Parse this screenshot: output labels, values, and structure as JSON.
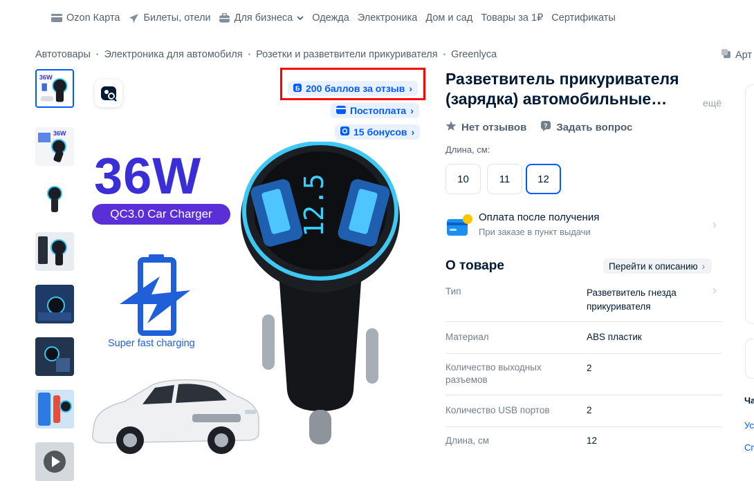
{
  "nav": {
    "items": [
      {
        "label": "Ozon Карта",
        "icon": "card-icon"
      },
      {
        "label": "Билеты, отели",
        "icon": "plane-icon"
      },
      {
        "label": "Для бизнеса",
        "icon": "business-icon",
        "dropdown": true
      },
      {
        "label": "Одежда"
      },
      {
        "label": "Электроника"
      },
      {
        "label": "Дом и сад"
      },
      {
        "label": "Товары за 1₽"
      },
      {
        "label": "Сертификаты"
      }
    ]
  },
  "breadcrumb": {
    "items": [
      "Автотовары",
      "Электроника для автомобиля",
      "Розетки и разветвители прикуривателя",
      "Greenlyca"
    ],
    "separator": "•",
    "article_label": "Арт"
  },
  "gallery": {
    "thumb_count": 8,
    "active_index": 0,
    "video_thumb": true
  },
  "main_image": {
    "headline": "36W",
    "subline": "QC3.0 Car Charger",
    "charging_caption": "Super fast charging",
    "display_reading": "12.5",
    "badges": {
      "reviews_points": "200 баллов за отзыв",
      "postpay": "Постоплата",
      "bonuses": "15 бонусов"
    }
  },
  "product": {
    "title": "Разветвитель прикуривателя (зарядка) автомобильные…",
    "more_label": "ещё",
    "rating_text": "Нет отзывов",
    "ask_question": "Задать вопрос",
    "length_label": "Длина, см:",
    "sizes": [
      "10",
      "11",
      "12"
    ],
    "selected_size": "12",
    "payment": {
      "title": "Оплата после получения",
      "subtitle": "При заказе в пункт выдачи"
    },
    "about_title": "О товаре",
    "goto_description": "Перейти к описанию",
    "specs": [
      {
        "key": "Тип",
        "value": "Разветвитель гнезда прикуривателя"
      },
      {
        "key": "Материал",
        "value": "ABS пластик"
      },
      {
        "key": "Количество выходных разъемов",
        "value": "2"
      },
      {
        "key": "Количество USB портов",
        "value": "2"
      },
      {
        "key": "Длина, см",
        "value": "12"
      }
    ]
  },
  "side_panel": {
    "heading_fragment": "Ча",
    "link1_fragment": "Ус",
    "link2_fragment": "Сп"
  },
  "colors": {
    "accent": "#005bff",
    "text": "#001a34",
    "muted": "#707f8d",
    "highlight_box": "#ff0000"
  }
}
